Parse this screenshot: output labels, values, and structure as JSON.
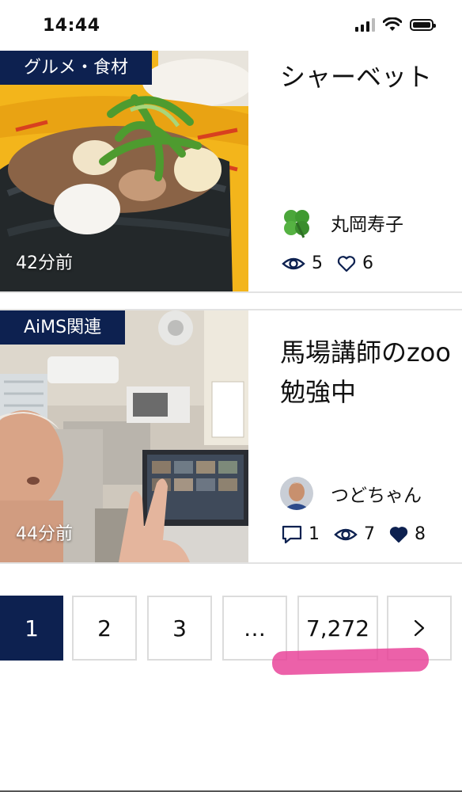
{
  "status_bar": {
    "time": "14:44"
  },
  "posts": [
    {
      "category": "グルメ・食材",
      "title_lines": [
        "シャーベット"
      ],
      "time_ago": "42分前",
      "author": "丸岡寿子",
      "views": "5",
      "likes": "6",
      "liked": false
    },
    {
      "category": "AiMS関連",
      "title_lines": [
        "馬場講師のzoo",
        "勉強中"
      ],
      "time_ago": "44分前",
      "author": "つどちゃん",
      "comments": "1",
      "views": "7",
      "likes": "8",
      "liked": true
    }
  ],
  "pagination": {
    "pages": [
      "1",
      "2",
      "3",
      "…",
      "7,272"
    ],
    "current": "1",
    "next_label": "›"
  },
  "colors": {
    "navy": "#0d2150",
    "highlight": "#e83e96"
  }
}
